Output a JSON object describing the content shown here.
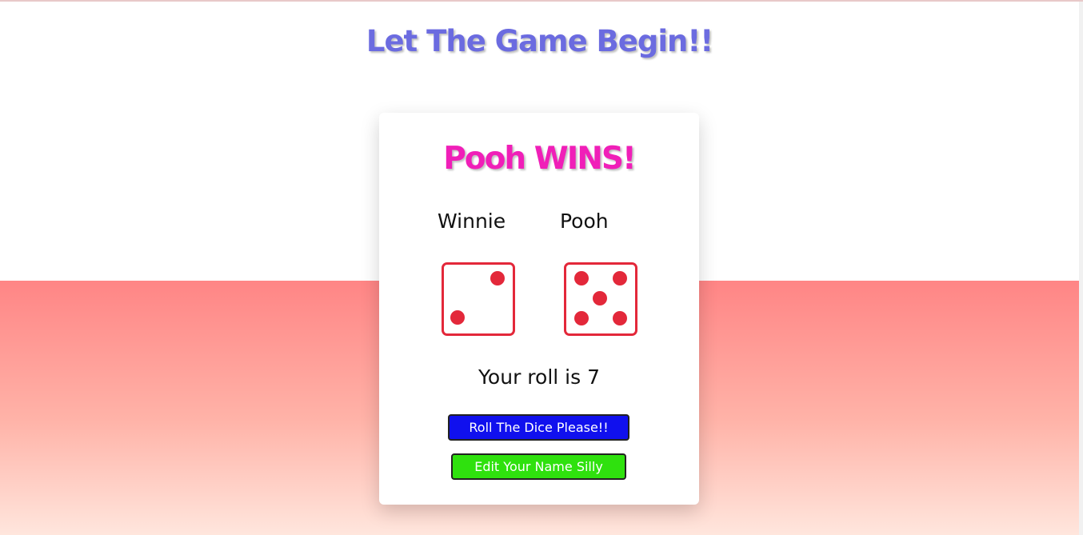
{
  "page": {
    "title": "Let The Game Begin!!"
  },
  "game": {
    "winner_text": "Pooh WINS!",
    "players": [
      {
        "name": "Winnie",
        "die_value": 2
      },
      {
        "name": "Pooh",
        "die_value": 5
      }
    ],
    "roll_text": "Your roll is 7"
  },
  "buttons": {
    "roll_label": "Roll The Dice Please!!",
    "edit_label": "Edit Your Name Silly"
  },
  "colors": {
    "title": "#6b6be0",
    "winner": "#f01fb8",
    "dice": "#e3283a",
    "roll_button": "#1010ee",
    "edit_button": "#2fe10e"
  }
}
